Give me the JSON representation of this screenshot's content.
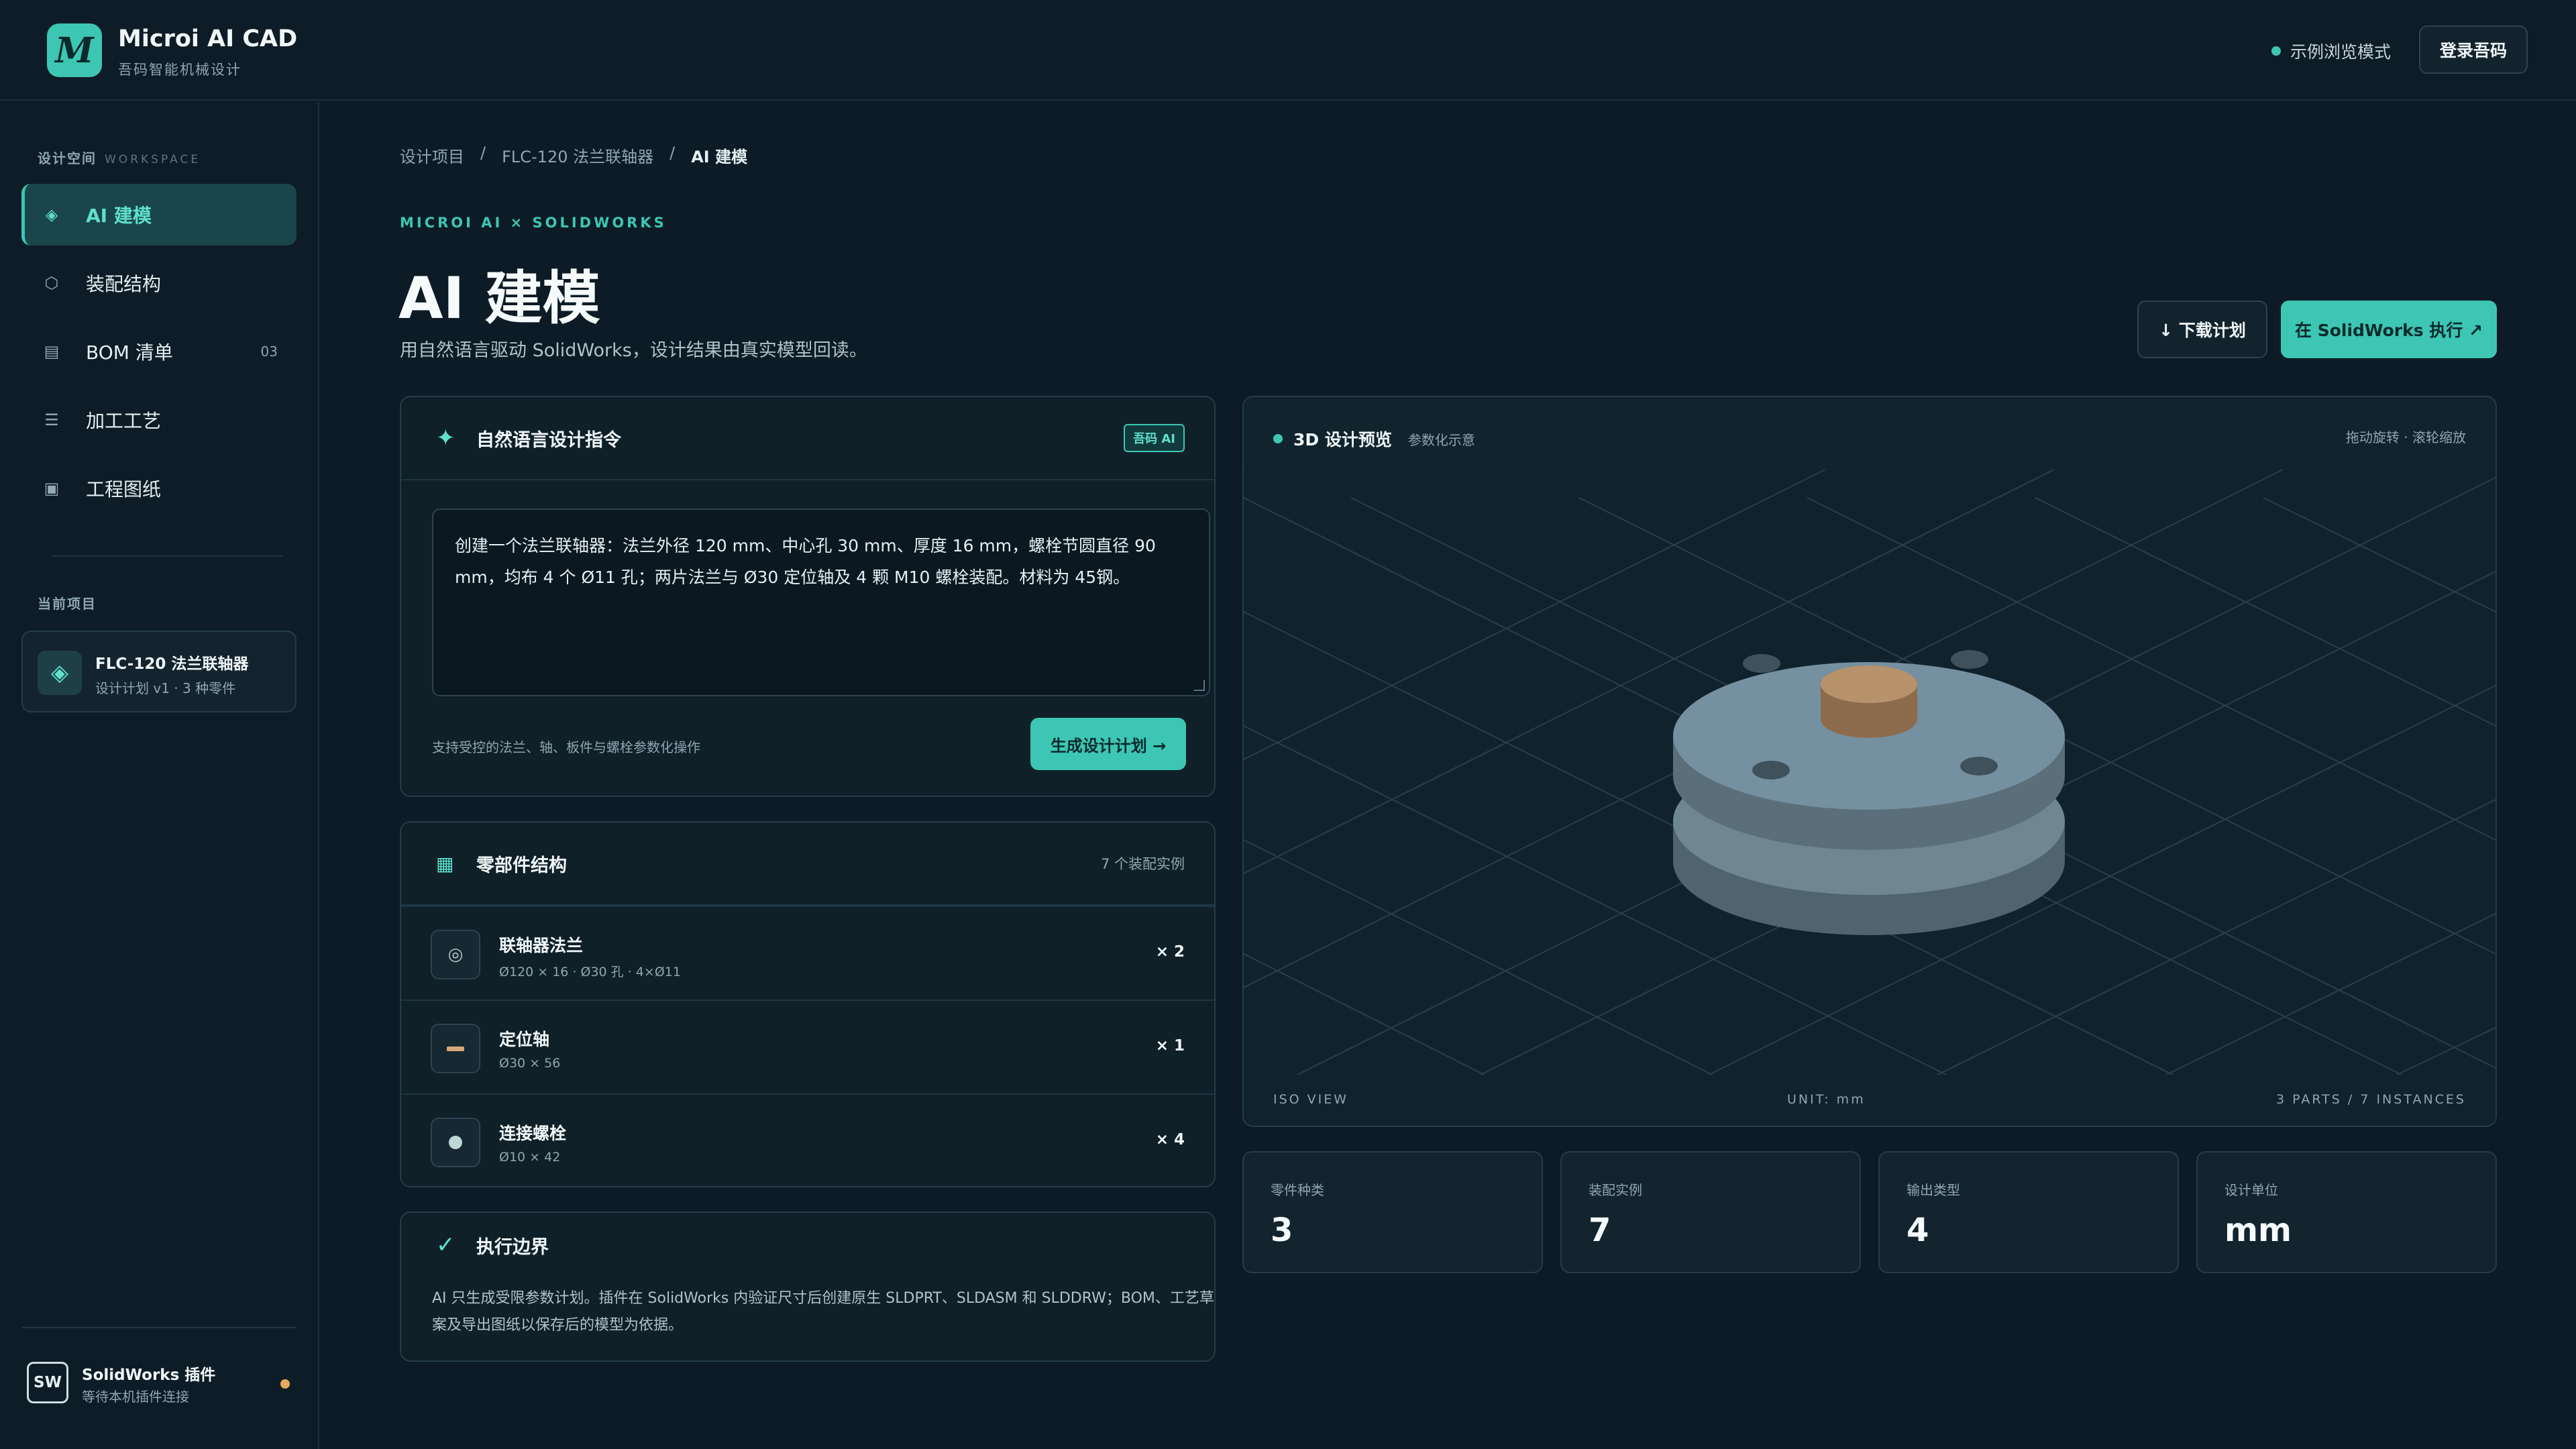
{
  "header": {
    "logo_letter": "M",
    "brand_title": "Microi AI CAD",
    "brand_sub": "吾码智能机械设计",
    "mode_label": "示例浏览模式",
    "login_label": "登录吾码"
  },
  "sidebar": {
    "section_label": "设计空间",
    "section_label_en": "WORKSPACE",
    "items": [
      {
        "label": "AI 建模",
        "icon": "cube-outline-icon"
      },
      {
        "label": "装配结构",
        "icon": "hexagon-icon"
      },
      {
        "label": "BOM 清单",
        "icon": "table-icon",
        "count": "03"
      },
      {
        "label": "加工工艺",
        "icon": "list-icon"
      },
      {
        "label": "工程图纸",
        "icon": "drawing-icon"
      }
    ],
    "current_label": "当前项目",
    "project": {
      "title": "FLC-120 法兰联轴器",
      "sub": "设计计划 v1 · 3 种零件"
    },
    "plugin": {
      "badge": "SW",
      "title": "SolidWorks 插件",
      "sub": "等待本机插件连接",
      "status_color": "#e4a95a"
    }
  },
  "main": {
    "breadcrumb": [
      "设计项目",
      "FLC-120 法兰联轴器",
      "AI 建模"
    ],
    "breadcrumb_sep": "/",
    "eyebrow": "MICROI AI × SOLIDWORKS",
    "title": "AI 建模",
    "subtitle": "用自然语言驱动 SolidWorks，设计结果由真实模型回读。",
    "download_label": "↓ 下载计划",
    "execute_label": "在 SolidWorks 执行 ↗"
  },
  "prompt_panel": {
    "title": "自然语言设计指令",
    "tag": "吾码 AI",
    "text": "创建一个法兰联轴器：法兰外径 120 mm、中心孔 30 mm、厚度 16 mm，螺栓节圆直径 90 mm，均布 4 个 Ø11 孔；两片法兰与 Ø30 定位轴及 4 颗 M10 螺栓装配。材料为 45钢。",
    "hint": "支持受控的法兰、轴、板件与螺栓参数化操作",
    "generate_label": "生成设计计划 →"
  },
  "parts_panel": {
    "title": "零部件结构",
    "count_label": "7 个装配实例",
    "parts": [
      {
        "name": "联轴器法兰",
        "spec": "Ø120 × 16 · Ø30 孔 · 4×Ø11",
        "qty": "× 2",
        "icon": "target-icon"
      },
      {
        "name": "定位轴",
        "spec": "Ø30 × 56",
        "qty": "× 1",
        "icon": "shaft-icon"
      },
      {
        "name": "连接螺栓",
        "spec": "Ø10 × 42",
        "qty": "× 4",
        "icon": "bolt-icon"
      }
    ]
  },
  "boundary_panel": {
    "title": "执行边界",
    "text": "AI 只生成受限参数计划。插件在 SolidWorks 内验证尺寸后创建原生 SLDPRT、SLDASM 和 SLDDRW；BOM、工艺草案及导出图纸以保存后的模型为依据。"
  },
  "preview": {
    "title": "3D 设计预览",
    "sub": "参数化示意",
    "hint": "拖动旋转 · 滚轮缩放",
    "footer_left": "ISO VIEW",
    "footer_center": "UNIT: mm",
    "footer_right": "3 PARTS / 7 INSTANCES"
  },
  "stats": [
    {
      "label": "零件种类",
      "value": "3"
    },
    {
      "label": "装配实例",
      "value": "7"
    },
    {
      "label": "输出类型",
      "value": "4"
    },
    {
      "label": "设计单位",
      "value": "mm"
    }
  ],
  "colors": {
    "accent": "#3cc6b3",
    "background": "#0c1b25",
    "warning": "#e4a95a",
    "shaft": "#b8926a",
    "flange": "#6f8791"
  }
}
